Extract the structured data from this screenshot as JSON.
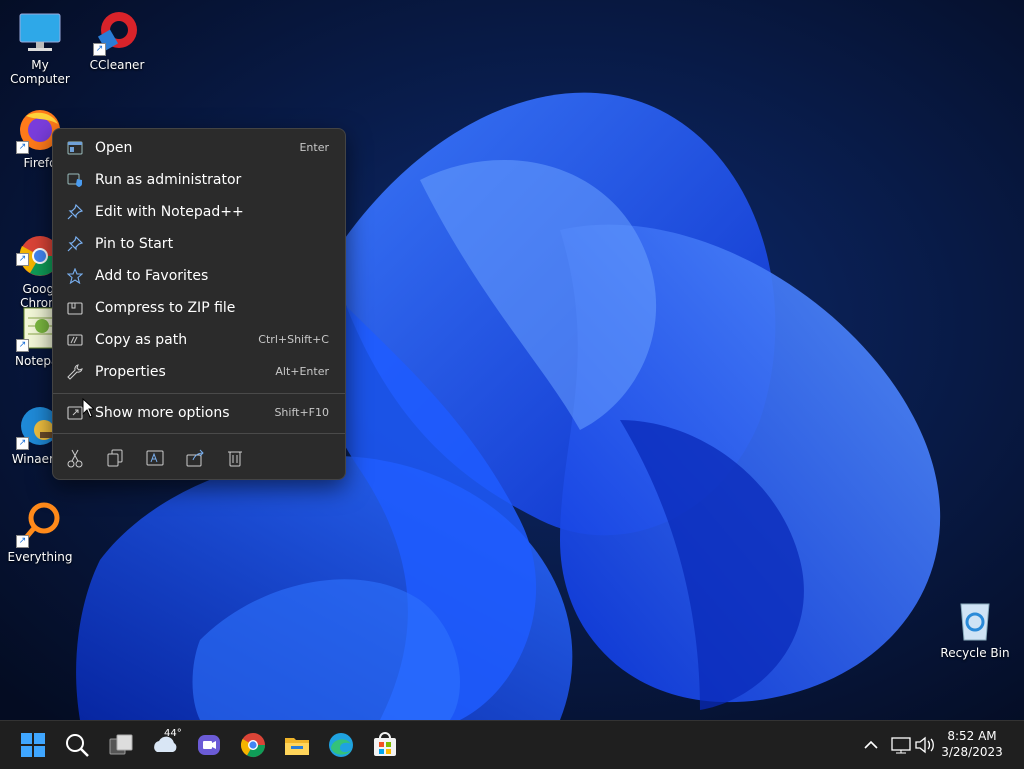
{
  "desktop": {
    "icons": [
      {
        "label": "My Computer"
      },
      {
        "label": "CCleaner"
      },
      {
        "label": "Firefo"
      },
      {
        "label": "Googl\nChrom"
      },
      {
        "label": "Notepac"
      },
      {
        "label": "WinaeroT"
      },
      {
        "label": "Everything"
      },
      {
        "label": "Recycle Bin"
      }
    ]
  },
  "context_menu": {
    "items": [
      {
        "label": "Open",
        "key": "Enter",
        "icon": "open-icon"
      },
      {
        "label": "Run as administrator",
        "key": "",
        "icon": "shield-icon"
      },
      {
        "label": "Edit with Notepad++",
        "key": "",
        "icon": "pin-icon"
      },
      {
        "label": "Pin to Start",
        "key": "",
        "icon": "pin-icon"
      },
      {
        "label": "Add to Favorites",
        "key": "",
        "icon": "star-icon"
      },
      {
        "label": "Compress to ZIP file",
        "key": "",
        "icon": "zip-icon"
      },
      {
        "label": "Copy as path",
        "key": "Ctrl+Shift+C",
        "icon": "path-icon"
      },
      {
        "label": "Properties",
        "key": "Alt+Enter",
        "icon": "wrench-icon"
      },
      {
        "label": "Show more options",
        "key": "Shift+F10",
        "icon": "more-options-icon"
      }
    ],
    "quick_actions": [
      "cut-icon",
      "copy-icon",
      "rename-icon",
      "share-icon",
      "delete-icon"
    ]
  },
  "taskbar": {
    "weather_temp": "44°",
    "time": "8:52 AM",
    "date": "3/28/2023",
    "icons": [
      "start-icon",
      "search-icon",
      "task-view-icon",
      "weather-icon",
      "chat-icon",
      "chrome-icon",
      "file-explorer-icon",
      "edge-icon",
      "store-icon"
    ],
    "tray": [
      "chevron-up-icon",
      "network-icon",
      "volume-icon"
    ]
  },
  "colors": {
    "accent": "#1a5cff",
    "menu_bg": "#2b2b2b",
    "taskbar_bg": "#1f1f1f"
  }
}
